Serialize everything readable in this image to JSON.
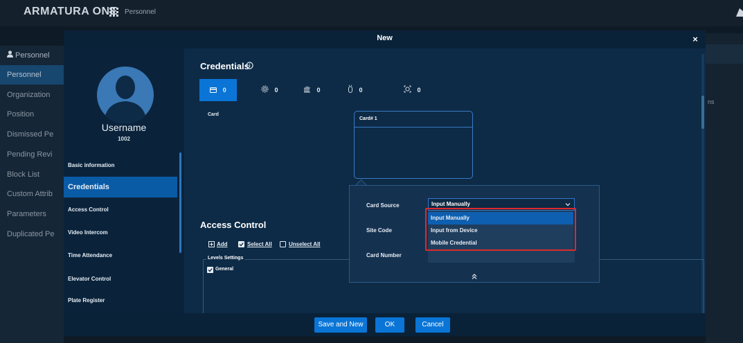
{
  "app": {
    "logo": "ARMATURA ONE",
    "module": "Personnel"
  },
  "bg_sidebar": {
    "header": "Personnel",
    "items": [
      {
        "label": "Personnel",
        "active": true
      },
      {
        "label": "Organization"
      },
      {
        "label": "Position"
      },
      {
        "label": "Dismissed Pe"
      },
      {
        "label": "Pending Revi"
      },
      {
        "label": "Block List"
      },
      {
        "label": "Custom Attrib"
      },
      {
        "label": "Parameters"
      },
      {
        "label": "Duplicated Pe"
      }
    ]
  },
  "bg_right": {
    "partial_text": "ns"
  },
  "dialog": {
    "title": "New",
    "close": "×",
    "profile": {
      "username": "Username",
      "user_id": "1002"
    },
    "menu": [
      {
        "label": "Basic information"
      },
      {
        "label": "Credentials",
        "active": true
      },
      {
        "label": "Access Control"
      },
      {
        "label": "Video Intercom"
      },
      {
        "label": "Time Attendance"
      },
      {
        "label": "Elevator Control"
      },
      {
        "label": "Plate Register"
      }
    ],
    "credentials": {
      "title": "Credentials",
      "tabs": [
        {
          "icon": "card-icon",
          "count": "0"
        },
        {
          "icon": "fingerprint-icon",
          "count": "0"
        },
        {
          "icon": "palm-icon",
          "count": "0"
        },
        {
          "icon": "finger-vein-icon",
          "count": "0"
        },
        {
          "icon": "face-icon",
          "count": "0"
        }
      ],
      "card_label": "Card",
      "card_box_title": "Card# 1"
    },
    "access_control": {
      "title": "Access Control",
      "add": "Add",
      "select_all": "Select All",
      "unselect_all": "Unselect All",
      "levels_legend": "Levels Settings",
      "levels": [
        {
          "label": "General",
          "checked": true
        }
      ]
    },
    "footer": {
      "save_new": "Save and New",
      "ok": "OK",
      "cancel": "Cancel"
    }
  },
  "popover": {
    "card_source_label": "Card Source",
    "site_code_label": "Site Code",
    "card_number_label": "Card Number",
    "selected": "Input Manually",
    "options": [
      "Input Manually",
      "Input from Device",
      "Mobile Credential"
    ],
    "highlight_color": "#e02a2a"
  },
  "colors": {
    "accent": "#0a75d6",
    "dialog_bg": "#0d2b47"
  }
}
